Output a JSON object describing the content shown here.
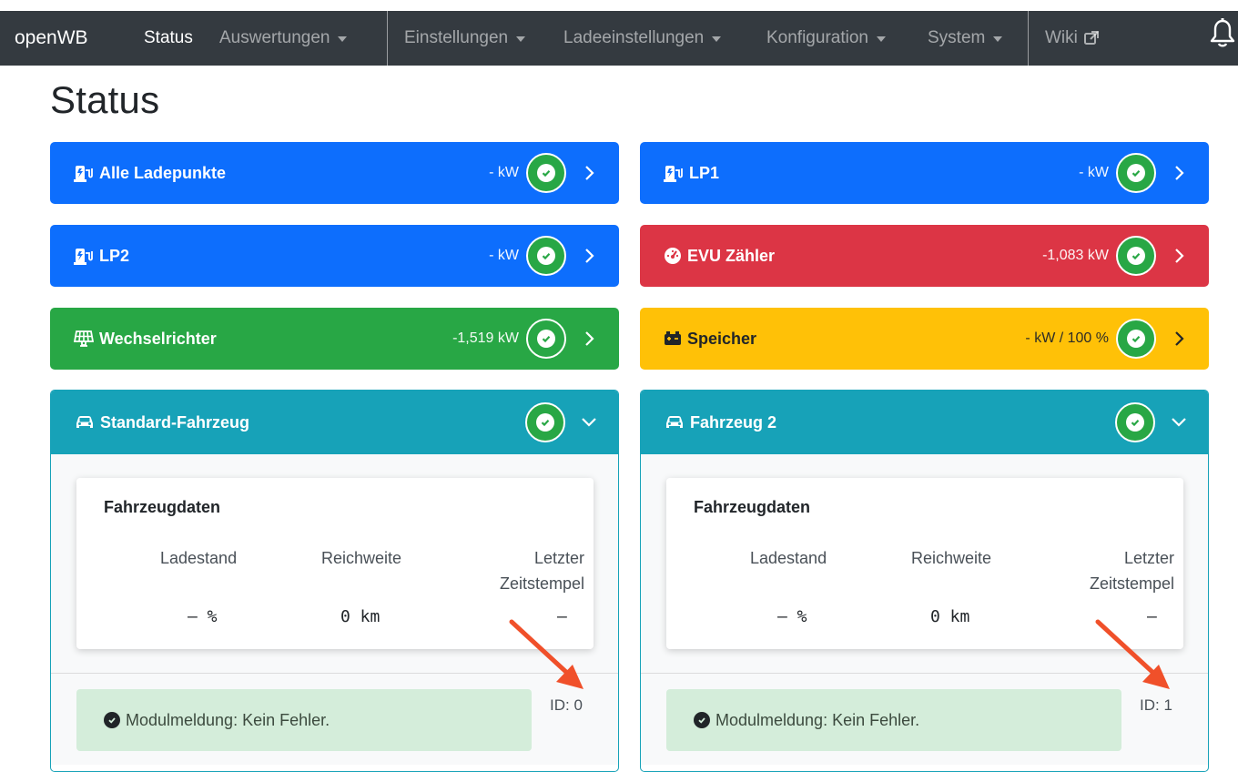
{
  "navbar": {
    "brand": "openWB",
    "items": {
      "status": "Status",
      "auswertungen": "Auswertungen",
      "einstellungen": "Einstellungen",
      "ladeeinstellungen": "Ladeeinstellungen",
      "konfiguration": "Konfiguration",
      "system": "System",
      "wiki": "Wiki"
    }
  },
  "page": {
    "title": "Status"
  },
  "cards": {
    "alle_ladepunkte": {
      "title": "Alle Ladepunkte",
      "value": "- kW"
    },
    "lp1": {
      "title": "LP1",
      "value": "- kW"
    },
    "lp2": {
      "title": "LP2",
      "value": "- kW"
    },
    "evu": {
      "title": "EVU Zähler",
      "value": "-1,083 kW"
    },
    "wechselrichter": {
      "title": "Wechselrichter",
      "value": "-1,519 kW"
    },
    "speicher": {
      "title": "Speicher",
      "value": "- kW / 100 %"
    }
  },
  "vehicles": [
    {
      "title": "Standard-Fahrzeug",
      "data_title": "Fahrzeugdaten",
      "labels": {
        "ladestand": "Ladestand",
        "reichweite": "Reichweite",
        "zeit_line1": "Letzter",
        "zeit_line2": "Zeitstempel"
      },
      "values": {
        "ladestand": "– %",
        "reichweite": "0 km",
        "zeit": "–"
      },
      "message": "Modulmeldung: Kein Fehler.",
      "id": "ID: 0"
    },
    {
      "title": "Fahrzeug 2",
      "data_title": "Fahrzeugdaten",
      "labels": {
        "ladestand": "Ladestand",
        "reichweite": "Reichweite",
        "zeit_line1": "Letzter",
        "zeit_line2": "Zeitstempel"
      },
      "values": {
        "ladestand": "– %",
        "reichweite": "0 km",
        "zeit": "–"
      },
      "message": "Modulmeldung: Kein Fehler.",
      "id": "ID: 1"
    }
  ],
  "colors": {
    "navbar": "#343a40",
    "primary": "#0d6efd",
    "danger": "#dc3545",
    "success": "#28a745",
    "warning": "#ffc107",
    "info": "#17a2b8",
    "alert_success_bg": "#d4edda",
    "annotation_arrow": "#f0502a"
  },
  "icons": {
    "charge_point": "charging-station-icon",
    "evu": "gauge-icon",
    "inverter": "solar-panel-icon",
    "battery": "car-battery-icon",
    "vehicle": "car-icon",
    "status_ok": "check-circle-icon",
    "expand": "chevron-right-icon",
    "collapse": "chevron-down-icon",
    "notifications": "bell-icon",
    "external_link": "external-link-icon"
  }
}
